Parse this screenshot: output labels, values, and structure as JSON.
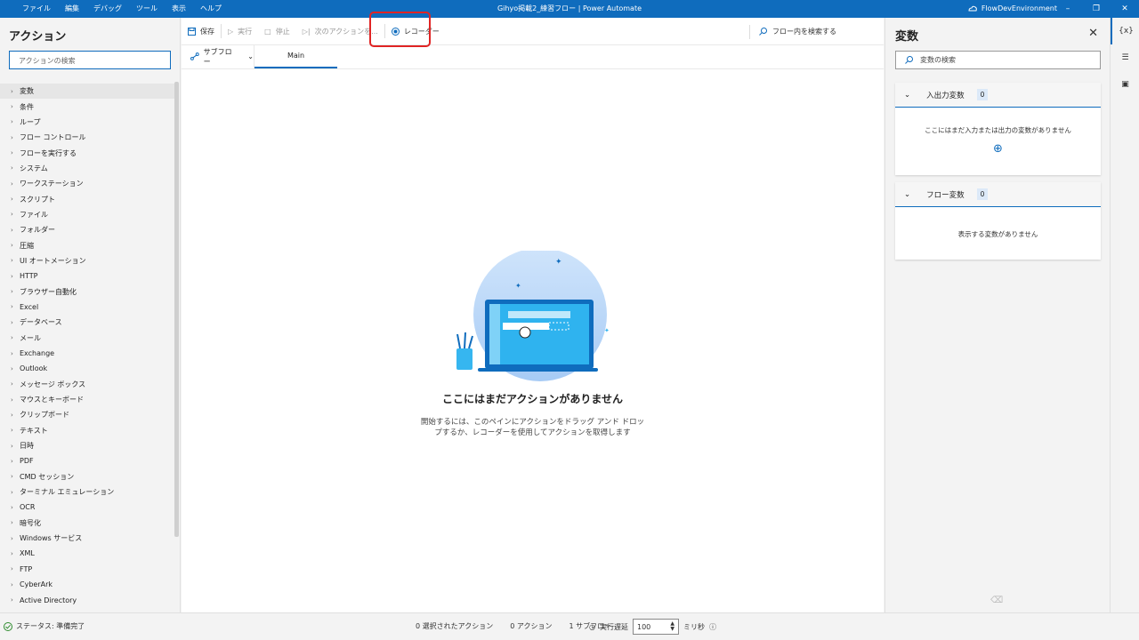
{
  "menu": [
    "ファイル",
    "編集",
    "デバッグ",
    "ツール",
    "表示",
    "ヘルプ"
  ],
  "window_title": "Gihyo掲載2_練習フロー | Power Automate",
  "environment": "FlowDevEnvironment",
  "actions_pane": {
    "title": "アクション",
    "search_placeholder": "アクションの検索",
    "groups": [
      "変数",
      "条件",
      "ループ",
      "フロー コントロール",
      "フローを実行する",
      "システム",
      "ワークステーション",
      "スクリプト",
      "ファイル",
      "フォルダー",
      "圧縮",
      "UI オートメーション",
      "HTTP",
      "ブラウザー自動化",
      "Excel",
      "データベース",
      "メール",
      "Exchange",
      "Outlook",
      "メッセージ ボックス",
      "マウスとキーボード",
      "クリップボード",
      "テキスト",
      "日時",
      "PDF",
      "CMD セッション",
      "ターミナル エミュレーション",
      "OCR",
      "暗号化",
      "Windows サービス",
      "XML",
      "FTP",
      "CyberArk",
      "Active Directory"
    ]
  },
  "toolbar": {
    "save": "保存",
    "run": "実行",
    "stop": "停止",
    "next_action": "次のアクションを...",
    "recorder": "レコーダー",
    "flow_search": "フロー内を検索する"
  },
  "tabs": {
    "subflow": "サブフロー",
    "main": "Main"
  },
  "empty_state": {
    "heading": "ここにはまだアクションがありません",
    "line1": "開始するには、このペインにアクションをドラッグ アンド ドロッ",
    "line2": "プするか、レコーダーを使用してアクションを取得します"
  },
  "variables_pane": {
    "title": "変数",
    "search_placeholder": "変数の検索",
    "io_title": "入出力変数",
    "io_count": "0",
    "io_empty": "ここにはまだ入力または出力の変数がありません",
    "flow_title": "フロー変数",
    "flow_count": "0",
    "flow_empty": "表示する変数がありません"
  },
  "rail": [
    "{x}"
  ],
  "status": {
    "state": "ステータス: 準備完了",
    "selected": "0 選択されたアクション",
    "actions": "0 アクション",
    "subflows": "1 サブフロー",
    "delay_label": "実行遅延",
    "delay_value": "100",
    "unit": "ミリ秒"
  },
  "colors": {
    "accent": "#0f6cbd",
    "highlight": "#e02424"
  }
}
